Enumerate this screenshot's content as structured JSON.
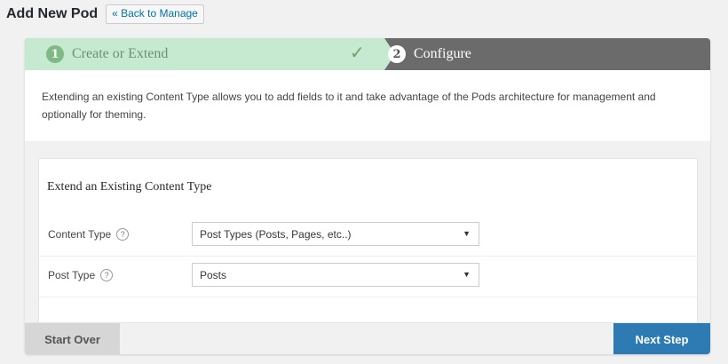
{
  "header": {
    "title": "Add New Pod",
    "back_link": "« Back to Manage"
  },
  "steps": [
    {
      "number": "1",
      "label": "Create or Extend",
      "status": "complete"
    },
    {
      "number": "2",
      "label": "Configure",
      "status": "active"
    }
  ],
  "intro_text": "Extending an existing Content Type allows you to add fields to it and take advantage of the Pods architecture for management and optionally for theming.",
  "form": {
    "heading": "Extend an Existing Content Type",
    "content_type": {
      "label": "Content Type",
      "value": "Post Types (Posts, Pages, etc..)"
    },
    "post_type": {
      "label": "Post Type",
      "value": "Posts"
    }
  },
  "footer": {
    "start_over": "Start Over",
    "next_step": "Next Step"
  },
  "icons": {
    "check": "check-icon",
    "help": "help-icon",
    "dropdown": "chevron-down-icon"
  },
  "colors": {
    "step_complete_bg": "#c5ead0",
    "step_active_bg": "#6b6b6b",
    "primary_button": "#2e7bb3",
    "link": "#0073aa"
  }
}
